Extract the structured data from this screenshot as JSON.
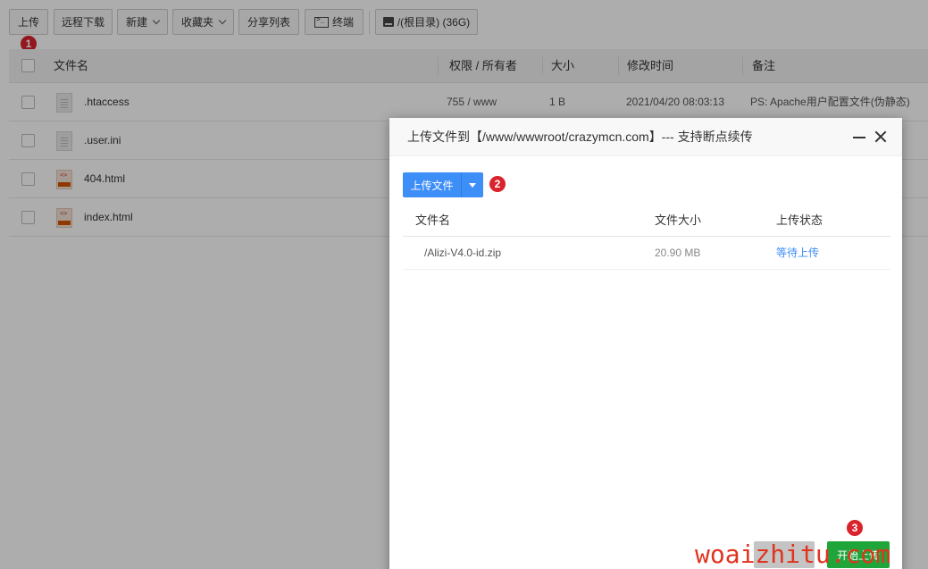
{
  "toolbar": {
    "upload": "上传",
    "remote_download": "远程下载",
    "new": "新建",
    "favorites": "收藏夹",
    "share_list": "分享列表",
    "terminal": "终端",
    "disk": "/(根目录) (36G)"
  },
  "badges": {
    "one": "1",
    "two": "2",
    "three": "3"
  },
  "file_table": {
    "headers": {
      "name": "文件名",
      "perm": "权限 / 所有者",
      "size": "大小",
      "mtime": "修改时间",
      "note": "备注"
    },
    "rows": [
      {
        "name": ".htaccess",
        "perm": "755 / www",
        "size": "1 B",
        "mtime": "2021/04/20 08:03:13",
        "note": "PS: Apache用户配置文件(伪静态)",
        "icon": "doc-icon"
      },
      {
        "name": ".user.ini",
        "icon": "doc-icon"
      },
      {
        "name": "404.html",
        "icon": "html-file-icon"
      },
      {
        "name": "index.html",
        "icon": "html-file-icon"
      }
    ]
  },
  "dialog": {
    "title": "上传文件到【/www/wwwroot/crazymcn.com】--- 支持断点续传",
    "upload_button": "上传文件",
    "headers": {
      "name": "文件名",
      "size": "文件大小",
      "status": "上传状态"
    },
    "files": [
      {
        "name": "/Alizi-V4.0-id.zip",
        "size": "20.90 MB",
        "status": "等待上传"
      }
    ],
    "start_button": "开始上传"
  },
  "watermark": "woaizhitu.com",
  "colors": {
    "primary": "#3e8ef7",
    "success": "#20a53a",
    "badge": "#d9232d",
    "watermark": "#e0341e"
  }
}
